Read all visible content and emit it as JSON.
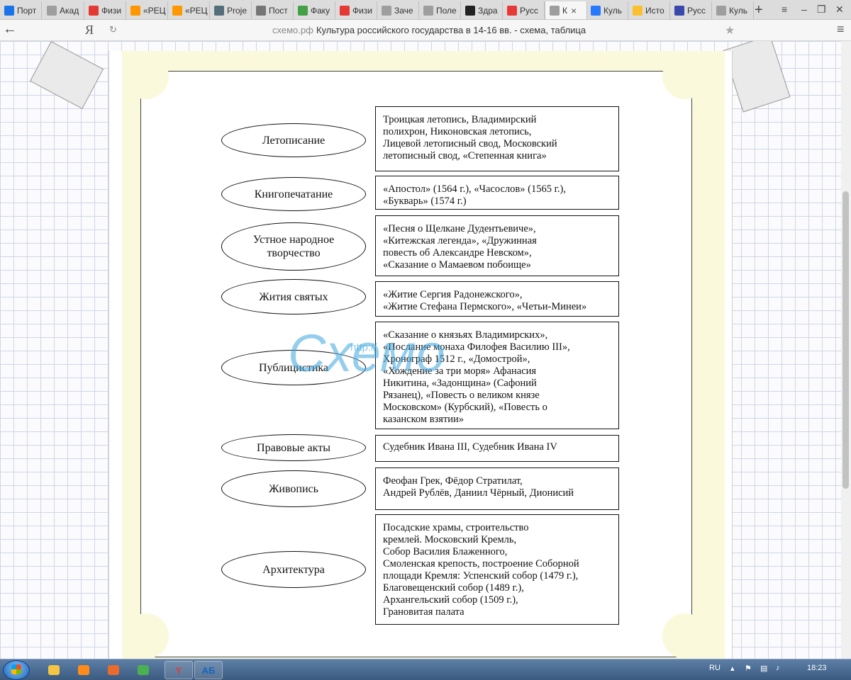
{
  "browser": {
    "tabs": [
      {
        "title": "Порт",
        "icon": "tp-logo-icon",
        "color": "#1a73e8"
      },
      {
        "title": "Акад",
        "icon": "page-icon",
        "color": "#9e9e9e"
      },
      {
        "title": "Физи",
        "icon": "youtube-icon",
        "color": "#e53935"
      },
      {
        "title": "«РЕЦ",
        "icon": "orange-badge-icon",
        "color": "#ff9800"
      },
      {
        "title": "«РЕЦ",
        "icon": "orange-badge-icon",
        "color": "#ff9800"
      },
      {
        "title": "Proje",
        "icon": "shield-icon",
        "color": "#546e7a"
      },
      {
        "title": "Пост",
        "icon": "building-icon",
        "color": "#757575"
      },
      {
        "title": "Факу",
        "icon": "puzzle-icon",
        "color": "#43a047"
      },
      {
        "title": "Физи",
        "icon": "youtube-icon",
        "color": "#e53935"
      },
      {
        "title": "Заче",
        "icon": "page-icon",
        "color": "#9e9e9e"
      },
      {
        "title": "Поле",
        "icon": "page-icon",
        "color": "#9e9e9e"
      },
      {
        "title": "Здра",
        "icon": "z-logo-icon",
        "color": "#212121"
      },
      {
        "title": "Русс",
        "icon": "yandex-icon",
        "color": "#e53935"
      },
      {
        "title": "К",
        "icon": "page-icon",
        "color": "#9e9e9e",
        "active": true
      },
      {
        "title": "Куль",
        "icon": "x-logo-icon",
        "color": "#2979ff"
      },
      {
        "title": "Исто",
        "icon": "smiley-icon",
        "color": "#fbc02d"
      },
      {
        "title": "Русс",
        "icon": "diamond-icon",
        "color": "#3949ab"
      },
      {
        "title": "Куль",
        "icon": "page-icon",
        "color": "#9e9e9e"
      }
    ],
    "new_tab_label": "+",
    "close_tab_label": "×",
    "yandex_logo": "Я",
    "domain": "схемо.рф",
    "page_title": "Культура российского государства в 14-16 вв. - схема, таблица"
  },
  "watermark": {
    "text": "Схемо",
    "url": "http://"
  },
  "scheme": {
    "rows": [
      {
        "category": [
          "Летописание"
        ],
        "lines": [
          "Троицкая летопись, Владимирский",
          "полихрон, Никоновская летопись,",
          "Лицевой летописный свод, Московский",
          "летописный свод, «Степенная книга»"
        ]
      },
      {
        "category": [
          "Книгопечатание"
        ],
        "lines": [
          "«Апостол» (1564 г.), «Часослов» (1565 г.),",
          "«Букварь» (1574 г.)"
        ]
      },
      {
        "category": [
          "Устное народное",
          "творчество"
        ],
        "lines": [
          "«Песня о Щелкане Дудентьевиче»,",
          "«Китежская легенда», «Дружинная",
          "повесть об Александре Невском»,",
          "«Сказание о Мамаевом побоище»"
        ]
      },
      {
        "category": [
          "Жития святых"
        ],
        "lines": [
          "«Житие Сергия Радонежского»,",
          "«Житие Стефана Пермского», «Четьи-Минеи»"
        ]
      },
      {
        "category": [
          "Публицистика"
        ],
        "lines": [
          "«Сказание о князьях Владимирских»,",
          "«Послание монаха Филофея Василию III»,",
          "Хронограф 1512 г., «Домострой»,",
          "«Хождение за три моря» Афанасия",
          "Никитина, «Задонщина» (Сафоний",
          "Рязанец), «Повесть о великом князе",
          "Московском» (Курбский), «Повесть о",
          "казанском взятии»"
        ]
      },
      {
        "category": [
          "Правовые акты"
        ],
        "lines": [
          "Судебник Ивана III, Судебник Ивана IV"
        ]
      },
      {
        "category": [
          "Живопись"
        ],
        "lines": [
          "Феофан Грек, Фёдор Стратилат,",
          "Андрей Рублёв, Даниил Чёрный, Дионисий"
        ]
      },
      {
        "category": [
          "Архитектура"
        ],
        "lines": [
          "Посадские храмы, строительство",
          "кремлей.  Московский Кремль,",
          "Собор Василия Блаженного,",
          "Смоленская крепость, построение Соборной",
          "площади Кремля: Успенский собор (1479 г.),",
          "Благовещенский собор (1489 г.),",
          "Архангельский собор (1509 г.),",
          "Грановитая палата"
        ]
      }
    ]
  },
  "taskbar": {
    "apps": [
      {
        "icon": "explorer-folder-icon",
        "color": "#f4c542"
      },
      {
        "icon": "media-player-icon",
        "color": "#ff8c1a"
      },
      {
        "icon": "paint-icon",
        "color": "#e86b2c"
      },
      {
        "icon": "torrent-icon",
        "color": "#4caf50"
      },
      {
        "icon": "yandex-browser-icon",
        "color": "#e53935",
        "label": "Y"
      },
      {
        "icon": "spellcheck-app-icon",
        "color": "#1565c0",
        "label": "АБ"
      }
    ],
    "lang": "RU",
    "clock": "18:23"
  }
}
